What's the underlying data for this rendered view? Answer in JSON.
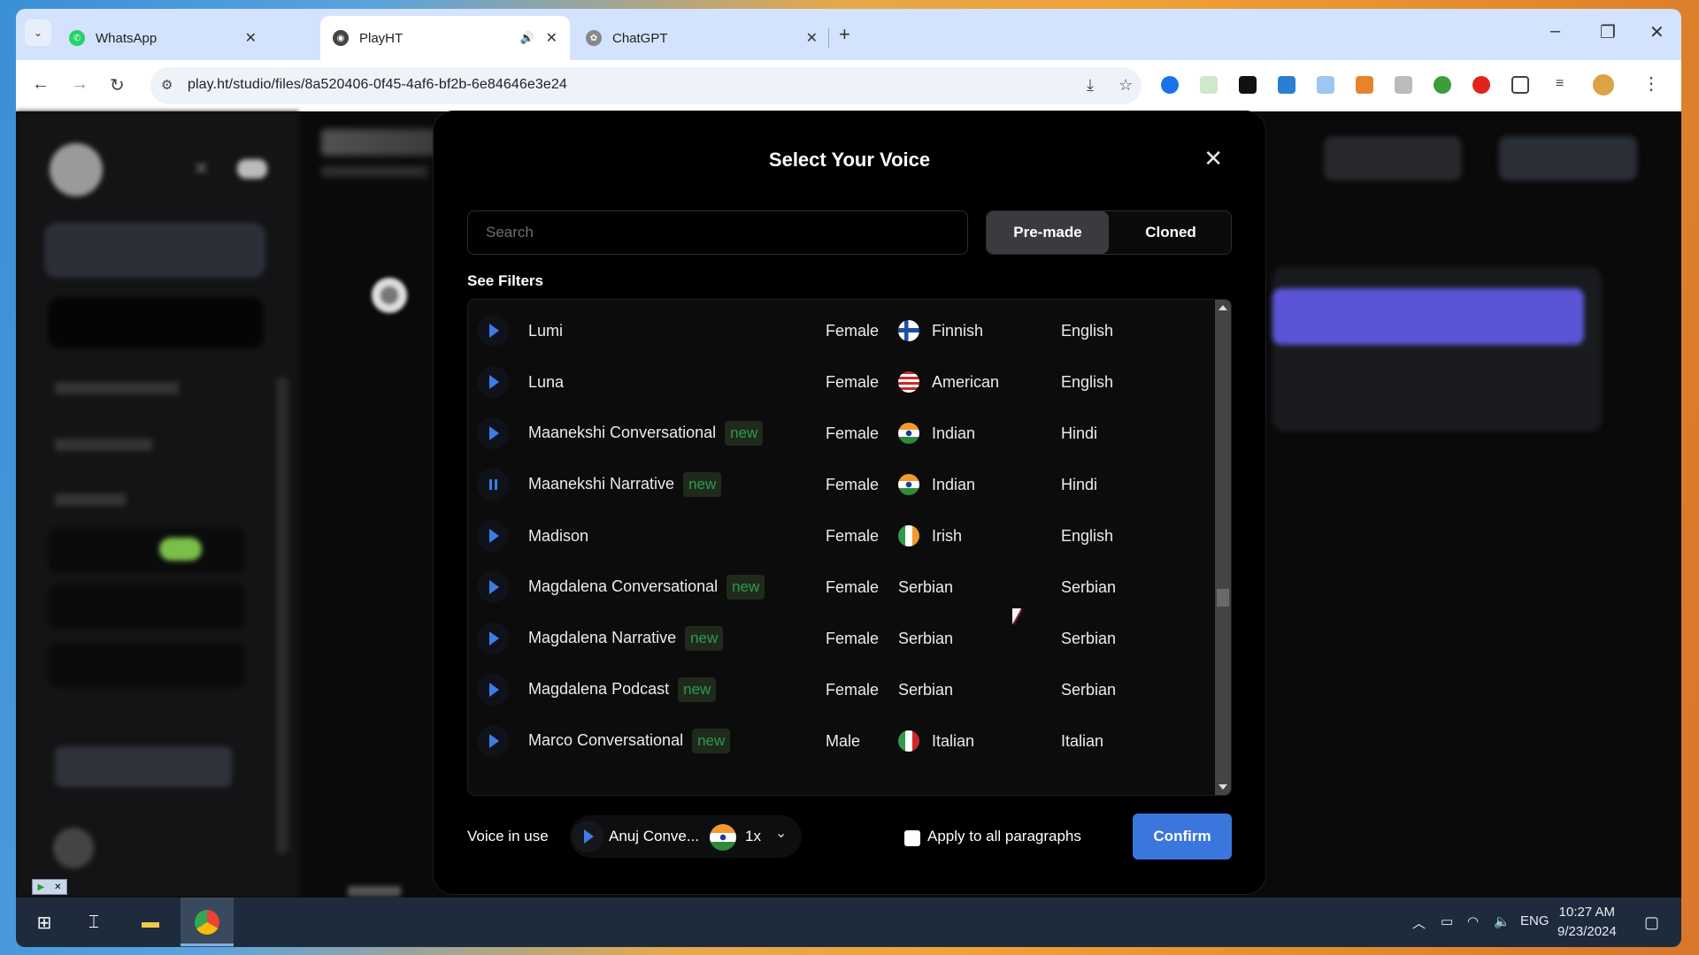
{
  "browser": {
    "tabs": [
      {
        "title": "WhatsApp",
        "icon": "whatsapp-icon",
        "active": false
      },
      {
        "title": "PlayHT",
        "icon": "playht-icon",
        "active": true,
        "audio": true
      },
      {
        "title": "ChatGPT",
        "icon": "chatgpt-icon",
        "active": false
      }
    ],
    "url": "play.ht/studio/files/8a520406-0f45-4af6-bf2b-6e84646e3e24",
    "icons": {
      "back": "←",
      "forward": "→",
      "reload": "↻",
      "site_info": "⚙",
      "install": "⤓",
      "star": "☆",
      "new_tab": "+",
      "tab_close": "✕",
      "audio": "🔊",
      "minimize": "–",
      "maximize": "❐",
      "close": "✕",
      "menu": "⋮",
      "tab_search": "⌄"
    }
  },
  "modal": {
    "title": "Select Your Voice",
    "close_icon": "✕",
    "search": {
      "placeholder": "Search",
      "value": ""
    },
    "segments": {
      "premade": "Pre-made",
      "cloned": "Cloned",
      "selected": "Pre-made"
    },
    "see_filters": "See Filters",
    "badge_label": "new",
    "voices": [
      {
        "name": "Lumi",
        "is_new": false,
        "gender": "Female",
        "flag": "finland",
        "accent": "Finnish",
        "language": "English",
        "playing": false
      },
      {
        "name": "Luna",
        "is_new": false,
        "gender": "Female",
        "flag": "usa",
        "accent": "American",
        "language": "English",
        "playing": false
      },
      {
        "name": "Maanekshi Conversational",
        "is_new": true,
        "gender": "Female",
        "flag": "india",
        "accent": "Indian",
        "language": "Hindi",
        "playing": false
      },
      {
        "name": "Maanekshi Narrative",
        "is_new": true,
        "gender": "Female",
        "flag": "india",
        "accent": "Indian",
        "language": "Hindi",
        "playing": true
      },
      {
        "name": "Madison",
        "is_new": false,
        "gender": "Female",
        "flag": "ireland",
        "accent": "Irish",
        "language": "English",
        "playing": false
      },
      {
        "name": "Magdalena Conversational",
        "is_new": true,
        "gender": "Female",
        "flag": null,
        "accent": "Serbian",
        "language": "Serbian",
        "playing": false
      },
      {
        "name": "Magdalena Narrative",
        "is_new": true,
        "gender": "Female",
        "flag": null,
        "accent": "Serbian",
        "language": "Serbian",
        "playing": false
      },
      {
        "name": "Magdalena Podcast",
        "is_new": true,
        "gender": "Female",
        "flag": null,
        "accent": "Serbian",
        "language": "Serbian",
        "playing": false
      },
      {
        "name": "Marco Conversational",
        "is_new": true,
        "gender": "Male",
        "flag": "italy",
        "accent": "Italian",
        "language": "Italian",
        "playing": false
      }
    ],
    "scroll_position": 0.6,
    "footer": {
      "voice_in_use_label": "Voice in use",
      "voice_in_use_name": "Anuj Conve...",
      "voice_in_use_flag": "india",
      "speed": "1x",
      "apply_all_label": "Apply to all paragraphs",
      "apply_all_checked": false,
      "confirm_label": "Confirm"
    }
  },
  "colors": {
    "accent_blue": "#3b76dc",
    "play_blue": "#3b7de8",
    "new_badge_text": "#2f9a4e",
    "new_badge_bg": "#1f2a1c",
    "generate_purple": "#5a55d4"
  },
  "taskbar": {
    "time": "10:27 AM",
    "date": "9/23/2024",
    "language": "ENG"
  }
}
